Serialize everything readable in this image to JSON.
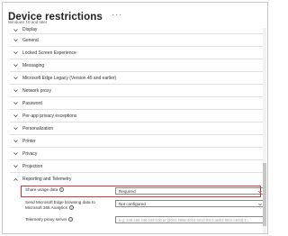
{
  "header": {
    "title": "Device restrictions",
    "more": "···",
    "subtitle": "Windows 10 and later"
  },
  "categories": [
    {
      "label": "Display"
    },
    {
      "label": "General"
    },
    {
      "label": "Locked Screen Experience"
    },
    {
      "label": "Messaging"
    },
    {
      "label": "Microsoft Edge Legacy (Version 45 and earlier)"
    },
    {
      "label": "Network proxy"
    },
    {
      "label": "Password"
    },
    {
      "label": "Per-app privacy exceptions"
    },
    {
      "label": "Personalization"
    },
    {
      "label": "Printer"
    },
    {
      "label": "Privacy"
    },
    {
      "label": "Projection"
    },
    {
      "label": "Reporting and Telemetry"
    }
  ],
  "settings": {
    "share_usage": {
      "label": "Share usage data",
      "value": "Required"
    },
    "edge_data": {
      "label": "Send Microsoft Edge browsing data to Microsoft 365 Analytics",
      "value": "Not configured"
    },
    "proxy": {
      "label": "Telemetry proxy server",
      "placeholder": "e.g. 249.166.246.109:100 or [2001:4898:4010:4013:93c1:a8b2:553c:c633]:1..."
    }
  },
  "colors": {
    "highlight": "#d13438",
    "divider": "#e1dfdd"
  }
}
